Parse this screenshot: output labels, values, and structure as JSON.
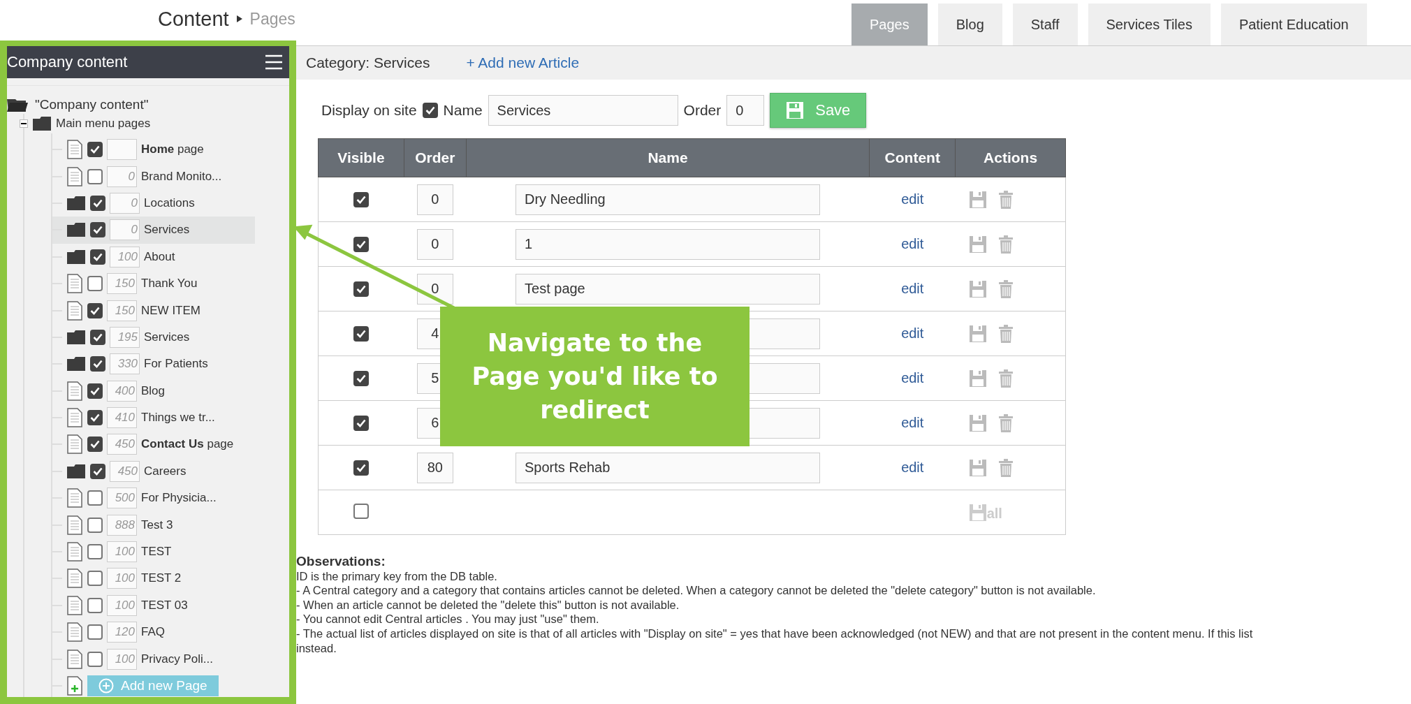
{
  "header": {
    "title": "Content",
    "crumb": "Pages"
  },
  "tabs": [
    {
      "label": "Pages",
      "selected": true
    },
    {
      "label": "Blog",
      "selected": false
    },
    {
      "label": "Staff",
      "selected": false
    },
    {
      "label": "Services Tiles",
      "selected": false
    },
    {
      "label": "Patient Education",
      "selected": false
    }
  ],
  "sidebar": {
    "title": "Company content",
    "tree": {
      "label": "\"Company content\"",
      "children": [
        {
          "label": "Main menu pages",
          "expanded": true,
          "children": [
            {
              "kind": "page",
              "checked": true,
              "name": "**Home** page",
              "selected": false
            },
            {
              "kind": "page",
              "checked": false,
              "order": "0",
              "name": "Brand Monito...",
              "selected": false
            },
            {
              "kind": "folder",
              "checked": true,
              "order": "0",
              "name": "Locations",
              "selected": false
            },
            {
              "kind": "folder",
              "checked": true,
              "order": "0",
              "name": "Services",
              "selected": true
            },
            {
              "kind": "folder",
              "checked": true,
              "order": "100",
              "name": "About",
              "selected": false
            },
            {
              "kind": "page",
              "checked": false,
              "order": "150",
              "name": "Thank You",
              "selected": false
            },
            {
              "kind": "page",
              "checked": true,
              "order": "150",
              "name": "NEW ITEM",
              "selected": false
            },
            {
              "kind": "folder",
              "checked": true,
              "order": "195",
              "name": "Services",
              "selected": false
            },
            {
              "kind": "folder",
              "checked": true,
              "order": "330",
              "name": "For Patients",
              "selected": false
            },
            {
              "kind": "page",
              "checked": true,
              "order": "400",
              "name": "Blog",
              "selected": false
            },
            {
              "kind": "page",
              "checked": true,
              "order": "410",
              "name": "Things we tr...",
              "selected": false
            },
            {
              "kind": "page",
              "checked": true,
              "order": "450",
              "name": "**Contact Us** page",
              "selected": false
            },
            {
              "kind": "folder",
              "checked": true,
              "order": "450",
              "name": "Careers",
              "selected": false
            },
            {
              "kind": "page",
              "checked": false,
              "order": "500",
              "name": "For Physicia...",
              "selected": false
            },
            {
              "kind": "page",
              "checked": false,
              "order": "888",
              "name": "Test 3",
              "selected": false
            },
            {
              "kind": "page",
              "checked": false,
              "order": "100",
              "name": "TEST",
              "selected": false
            },
            {
              "kind": "page",
              "checked": false,
              "order": "100",
              "name": "TEST 2",
              "selected": false
            },
            {
              "kind": "page",
              "checked": false,
              "order": "100",
              "name": "TEST 03",
              "selected": false
            },
            {
              "kind": "page",
              "checked": false,
              "order": "120",
              "name": "FAQ",
              "selected": false
            },
            {
              "kind": "page",
              "checked": false,
              "order": "100",
              "name": "Privacy Poli...",
              "selected": false
            }
          ],
          "add_button": "Add new Page"
        }
      ]
    }
  },
  "category_bar": {
    "title": "Category: Services",
    "link": "+ Add new Article"
  },
  "form": {
    "display_label": "Display on site",
    "display_checked": true,
    "name_label": "Name",
    "name_value": "Services",
    "order_label": "Order",
    "order_value": "0",
    "save": "Save"
  },
  "table": {
    "columns": [
      "Visible",
      "Order",
      "Name",
      "Content",
      "Actions"
    ],
    "rows": [
      {
        "visible": true,
        "order": "0",
        "name": "Dry Needling",
        "content": "edit"
      },
      {
        "visible": true,
        "order": "0",
        "name": "1",
        "content": "edit"
      },
      {
        "visible": true,
        "order": "0",
        "name": "Test page",
        "content": "edit"
      },
      {
        "visible": true,
        "order": "4",
        "content": "edit"
      },
      {
        "visible": true,
        "order": "5",
        "content": "edit"
      },
      {
        "visible": true,
        "order": "6",
        "content": "edit"
      },
      {
        "visible": true,
        "order": "80",
        "name": "Sports Rehab",
        "content": "edit"
      }
    ],
    "footer": {
      "visible": false,
      "save_all": "all"
    }
  },
  "callout": {
    "text": "Navigate to the Page you'd like to redirect"
  },
  "observations": {
    "title": "Observations:",
    "lines": [
      "ID is the primary key from the DB table.",
      "- A Central category and a category that contains articles cannot be deleted. When a category cannot be deleted the \"delete category\" button is not available.",
      "- When an article cannot be deleted the \"delete this\" button is not available.",
      "- You cannot edit Central articles . You may just \"use\" them.",
      "- The actual list of articles displayed on site is that of all articles with \"Display on site\" = yes that have been acknowledged (not NEW) and that are not present in the content menu. If this list",
      "instead."
    ]
  }
}
